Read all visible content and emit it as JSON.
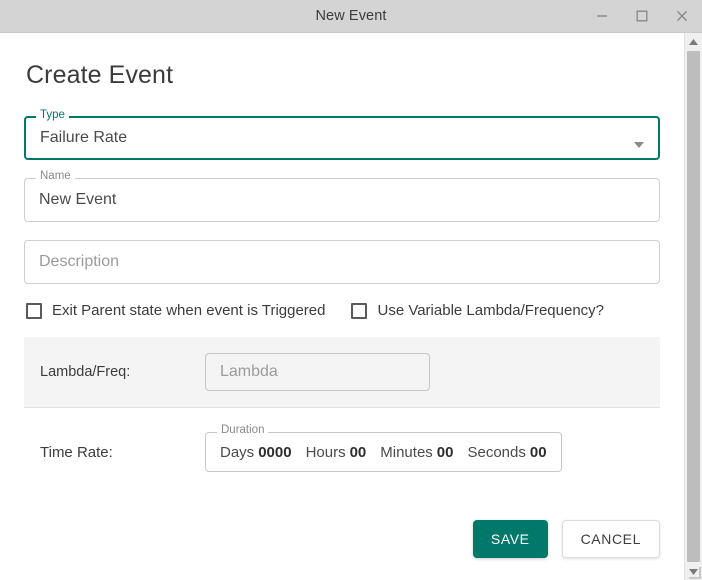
{
  "titlebar": {
    "title": "New Event",
    "minimize_label": "minimize",
    "maximize_label": "maximize",
    "close_label": "close"
  },
  "colors": {
    "accent": "#00796B",
    "titlebar_bg": "#D4D4D4",
    "panel_bg": "#F4F4F4",
    "field_border": "#CFCFCF",
    "text": "#3C3C3C",
    "placeholder": "#9B9B9B"
  },
  "page_title": "Create Event",
  "fields": {
    "type": {
      "label": "Type",
      "value": "Failure Rate",
      "focused": true,
      "dropdown_icon": "chevron-down-icon"
    },
    "name": {
      "label": "Name",
      "value": "New Event",
      "focused": false
    },
    "description": {
      "label": "",
      "value": "",
      "placeholder": "Description",
      "focused": false
    }
  },
  "checkboxes": [
    {
      "name": "exit-parent-state",
      "label": "Exit Parent state when event is Triggered",
      "checked": false
    },
    {
      "name": "use-variable-lambda",
      "label": "Use Variable Lambda/Frequency?",
      "checked": false
    }
  ],
  "lambda_panel": {
    "label": "Lambda/Freq:",
    "input_placeholder": "Lambda",
    "input_value": ""
  },
  "time_rate": {
    "label": "Time Rate:",
    "duration_legend": "Duration",
    "segments": [
      {
        "unit": "Days",
        "value": "0000"
      },
      {
        "unit": "Hours",
        "value": "00"
      },
      {
        "unit": "Minutes",
        "value": "00"
      },
      {
        "unit": "Seconds",
        "value": "00"
      }
    ]
  },
  "actions": {
    "save_label": "SAVE",
    "cancel_label": "CANCEL"
  },
  "scrollbar": {
    "up_icon": "caret-up-icon",
    "down_icon": "caret-down-icon"
  }
}
